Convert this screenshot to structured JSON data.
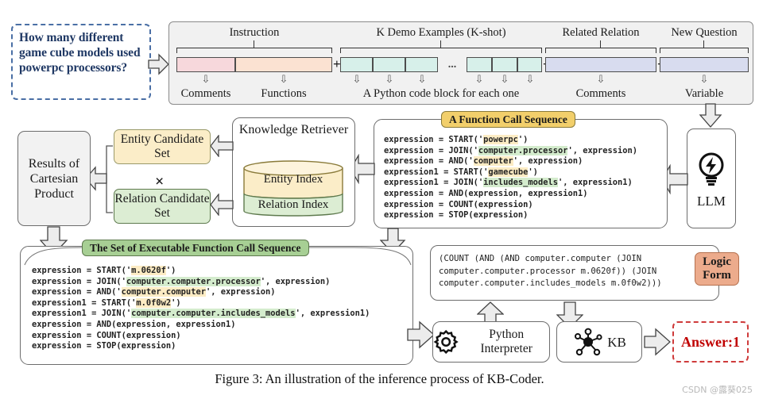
{
  "figure": {
    "caption": "Figure 3: An illustration of the inference process of KB-Coder.",
    "watermark": "CSDN @露葵025"
  },
  "question": {
    "text": "How many different game cube models used powerpc processors?"
  },
  "prompt": {
    "segments": [
      {
        "title": "Instruction",
        "foot": [
          "Comments",
          "Functions"
        ],
        "blocks": [
          "#f7d8dc",
          "#fbe2d2"
        ]
      },
      {
        "title": "K Demo Examples (K-shot)",
        "foot": [
          "A Python code block for each one"
        ],
        "blocks": [
          "#d7f0ea",
          "#d7f0ea",
          "#d7f0ea",
          "#d7f0ea",
          "#d7f0ea",
          "#d7f0ea"
        ]
      },
      {
        "title": "Related Relation",
        "foot": [
          "Comments"
        ],
        "blocks": [
          "#d8dcef"
        ]
      },
      {
        "title": "New Question",
        "foot": [
          "Variable"
        ],
        "blocks": [
          "#d8dcef"
        ]
      }
    ],
    "ellipsis": "...",
    "plus": "+"
  },
  "nodes": {
    "results_cartesian": "Results of Cartesian Product",
    "entity_candidate": "Entity Candidate Set",
    "relation_candidate": "Relation Candidate Set",
    "times_symbol": "×",
    "knowledge_retriever": "Knowledge Retriever",
    "entity_index": "Entity Index",
    "relation_index": "Relation Index",
    "llm": "LLM",
    "python_interpreter": "Python Interpreter",
    "kb": "KB",
    "answer": "Answer:1",
    "logic_form": "Logic Form"
  },
  "function_call_sequence": {
    "title": "A Function Call Sequence",
    "lines": [
      [
        {
          "t": "expression = START('",
          "h": "none"
        },
        {
          "t": "powerpc",
          "h": "e"
        },
        {
          "t": "')",
          "h": "none"
        }
      ],
      [
        {
          "t": "expression = JOIN('",
          "h": "none"
        },
        {
          "t": "computer.processor",
          "h": "r"
        },
        {
          "t": "', expression)",
          "h": "none"
        }
      ],
      [
        {
          "t": "expression = AND('",
          "h": "none"
        },
        {
          "t": "computer",
          "h": "e"
        },
        {
          "t": "', expression)",
          "h": "none"
        }
      ],
      [
        {
          "t": "expression1 = START('",
          "h": "none"
        },
        {
          "t": "gamecube",
          "h": "e"
        },
        {
          "t": "')",
          "h": "none"
        }
      ],
      [
        {
          "t": "expression1 = JOIN('",
          "h": "none"
        },
        {
          "t": "includes_models",
          "h": "r"
        },
        {
          "t": "', expression1)",
          "h": "none"
        }
      ],
      [
        {
          "t": "expression = AND(expression, expression1)",
          "h": "none"
        }
      ],
      [
        {
          "t": "expression = COUNT(expression)",
          "h": "none"
        }
      ],
      [
        {
          "t": "expression = STOP(expression)",
          "h": "none"
        }
      ]
    ]
  },
  "executable_sequence": {
    "title": "The Set of Executable Function Call Sequence",
    "lines": [
      [
        {
          "t": "expression = START('",
          "h": "none"
        },
        {
          "t": "m.0620f",
          "h": "e"
        },
        {
          "t": "')",
          "h": "none"
        }
      ],
      [
        {
          "t": "expression = JOIN('",
          "h": "none"
        },
        {
          "t": "computer.computer.processor",
          "h": "r"
        },
        {
          "t": "', expression)",
          "h": "none"
        }
      ],
      [
        {
          "t": "expression = AND('",
          "h": "none"
        },
        {
          "t": "computer.computer",
          "h": "e"
        },
        {
          "t": "', expression)",
          "h": "none"
        }
      ],
      [
        {
          "t": "expression1 = START('",
          "h": "none"
        },
        {
          "t": "m.0f0w2",
          "h": "e"
        },
        {
          "t": "')",
          "h": "none"
        }
      ],
      [
        {
          "t": "expression1 = JOIN('",
          "h": "none"
        },
        {
          "t": "computer.computer.includes_models",
          "h": "r"
        },
        {
          "t": "', expression1)",
          "h": "none"
        }
      ],
      [
        {
          "t": "expression = AND(expression, expression1)",
          "h": "none"
        }
      ],
      [
        {
          "t": "expression = COUNT(expression)",
          "h": "none"
        }
      ],
      [
        {
          "t": "expression = STOP(expression)",
          "h": "none"
        }
      ]
    ]
  },
  "logic_form": {
    "text": "(COUNT (AND (AND computer.computer (JOIN computer.computer.processor m.0620f)) (JOIN computer.computer.includes_models m.0f0w2)))"
  },
  "colors": {
    "entity_highlight": "#fdecc4",
    "relation_highlight": "#d4eccd",
    "entity_panel": "#fbedc8",
    "relation_panel": "#dcedd3",
    "fcs_badge": "#f2cf6b",
    "exec_badge": "#a7cf94",
    "logic_badge": "#ecab8c",
    "answer_red": "#c00000",
    "question_blue": "#1f3864"
  }
}
